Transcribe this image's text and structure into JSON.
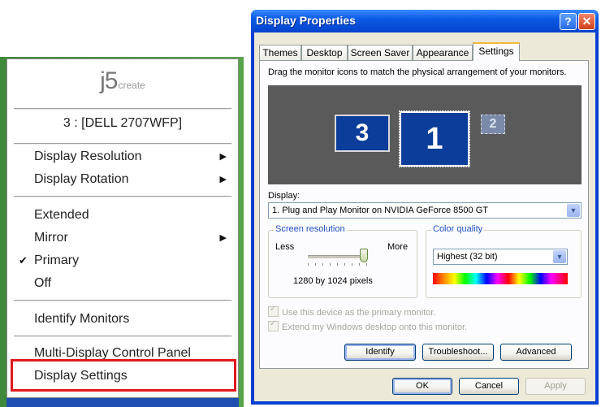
{
  "j5menu": {
    "logo_big": "j5",
    "logo_small": "create",
    "monitor": "3 : [DELL 2707WFP]",
    "items": [
      {
        "label": "Display Resolution"
      },
      {
        "label": "Display Rotation"
      },
      {
        "label": "Extended"
      },
      {
        "label": "Mirror"
      },
      {
        "label": "Primary"
      },
      {
        "label": "Off"
      },
      {
        "label": "Identify Monitors"
      },
      {
        "label": "Multi-Display Control Panel"
      },
      {
        "label": "Display Settings"
      }
    ],
    "submenu_glyph": "▶",
    "check_glyph": "✔"
  },
  "dialog": {
    "title": "Display Properties",
    "help_glyph": "?",
    "close_glyph": "✕",
    "tabs": [
      "Themes",
      "Desktop",
      "Screen Saver",
      "Appearance",
      "Settings"
    ],
    "active_tab": "Settings",
    "instruction": "Drag the monitor icons to match the physical arrangement of your monitors.",
    "monitors": [
      "3",
      "1",
      "2"
    ],
    "display_label": "Display:",
    "display_value": "1. Plug and Play Monitor on NVIDIA GeForce 8500 GT",
    "screen_resolution": {
      "group_title": "Screen resolution",
      "less": "Less",
      "more": "More",
      "value": "1280 by 1024 pixels"
    },
    "color_quality": {
      "group_title": "Color quality",
      "value": "Highest (32 bit)"
    },
    "checkbox_primary": "Use this device as the primary monitor.",
    "checkbox_extend": "Extend my Windows desktop onto this monitor.",
    "buttons": {
      "identify": "Identify",
      "troubleshoot": "Troubleshoot...",
      "advanced": "Advanced",
      "ok": "OK",
      "cancel": "Cancel",
      "apply": "Apply"
    },
    "dropdown_glyph": "▼"
  }
}
